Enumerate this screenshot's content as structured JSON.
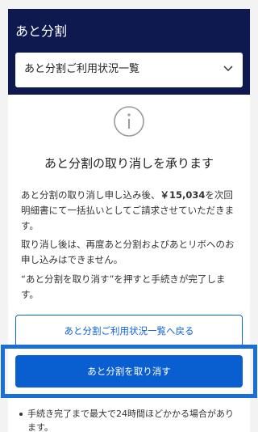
{
  "header": {
    "title": "あと分割",
    "select_value": "あと分割ご利用状況一覧"
  },
  "icons": {
    "info": "info-icon",
    "chevron": "chevron-down-icon"
  },
  "card": {
    "heading": "あと分割の取り消しを承ります",
    "paragraph1_before": "あと分割の取り消し申し込み後、",
    "paragraph1_amount": "￥15,034",
    "paragraph1_after": "を次回明細書にて一括払いとしてご請求させていただきます。",
    "paragraph2": "取り消し後は、再度あと分割およびあとリボへのお申し込みはできません。",
    "paragraph3": "“あと分割を取り消す”を押すと手続きが完了します。",
    "back_button": "あと分割ご利用状況一覧へ戻る",
    "cancel_button": "あと分割を取り消す",
    "note": "手続き完了まで最大で24時間ほどかかる場合があります。"
  },
  "colors": {
    "header_bg": "#0e1a4f",
    "primary": "#0a5fd0",
    "highlight": "#1a6fd4"
  }
}
